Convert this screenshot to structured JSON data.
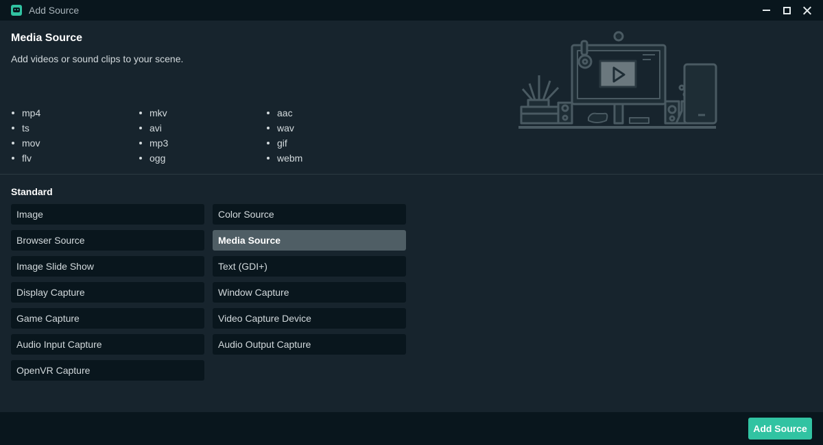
{
  "window": {
    "title": "Add Source",
    "icon": "streamlabs-icon"
  },
  "source_info": {
    "title": "Media Source",
    "description": "Add videos or sound clips to your scene.",
    "formats": [
      "mp4",
      "ts",
      "mov",
      "flv",
      "mkv",
      "avi",
      "mp3",
      "ogg",
      "aac",
      "wav",
      "gif",
      "webm"
    ]
  },
  "sections": {
    "standard": {
      "label": "Standard",
      "left_column": [
        "Image",
        "Browser Source",
        "Image Slide Show",
        "Display Capture",
        "Game Capture",
        "Audio Input Capture",
        "OpenVR Capture"
      ],
      "right_column": [
        "Color Source",
        "Media Source",
        "Text (GDI+)",
        "Window Capture",
        "Video Capture Device",
        "Audio Output Capture"
      ],
      "selected": "Media Source"
    }
  },
  "footer": {
    "add_label": "Add Source"
  },
  "colors": {
    "background": "#17242d",
    "titlebar": "#09161d",
    "button": "#09161d",
    "selected_button": "#4f5e65",
    "accent": "#31c3a2"
  }
}
